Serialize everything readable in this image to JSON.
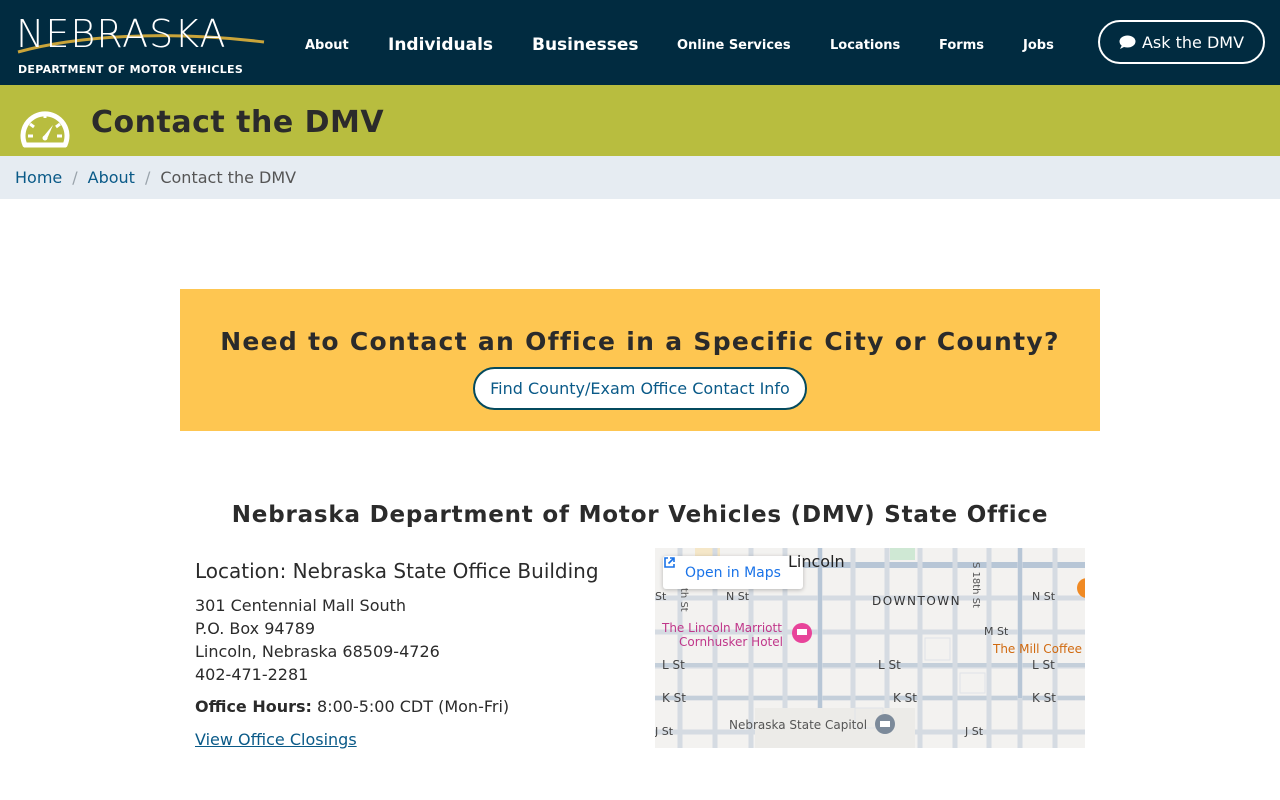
{
  "header": {
    "logo_word": "NEBRASKA",
    "logo_sub": "DEPARTMENT OF MOTOR VEHICLES",
    "nav": {
      "about": "About",
      "individuals": "Individuals",
      "businesses": "Businesses",
      "online_services": "Online Services",
      "locations": "Locations",
      "forms": "Forms",
      "jobs": "Jobs"
    },
    "ask_button": "Ask the DMV"
  },
  "title_band": {
    "title": "Contact the DMV"
  },
  "breadcrumb": {
    "home": "Home",
    "about": "About",
    "current": "Contact the DMV"
  },
  "callout": {
    "title": "Need to Contact an Office in a Specific City or County?",
    "button": "Find County/Exam Office Contact Info"
  },
  "office": {
    "heading": "Nebraska Department of Motor Vehicles (DMV) State Office",
    "location": "Location: Nebraska State Office Building",
    "address": [
      "301 Centennial Mall South",
      "P.O. Box 94789",
      "Lincoln, Nebraska 68509-4726",
      "402-471-2281"
    ],
    "hours_label": "Office Hours:",
    "hours_value": " 8:00-5:00 CDT (Mon-Fri)",
    "closings_link": "View Office Closings"
  },
  "map": {
    "open_button": "Open in Maps",
    "labels": {
      "city": "Lincoln",
      "downtown": "DOWNTOWN",
      "n_st_left": "N St",
      "n_st_right": "N St",
      "m_st": "M St",
      "l_st_left": "L St",
      "l_st_mid": "L St",
      "l_st_right": "L St",
      "k_st_left": "K St",
      "k_st_mid": "K St",
      "k_st_right": "K St",
      "j_st_left": "J St",
      "j_st_right": "J St",
      "st_left": "St",
      "s18": "S 18th St",
      "s9": "th St",
      "hotel1": "The Lincoln Marriott",
      "hotel2": "Cornhusker Hotel",
      "capitol": "Nebraska State Capitol",
      "coffee": "The Mill Coffee"
    }
  }
}
